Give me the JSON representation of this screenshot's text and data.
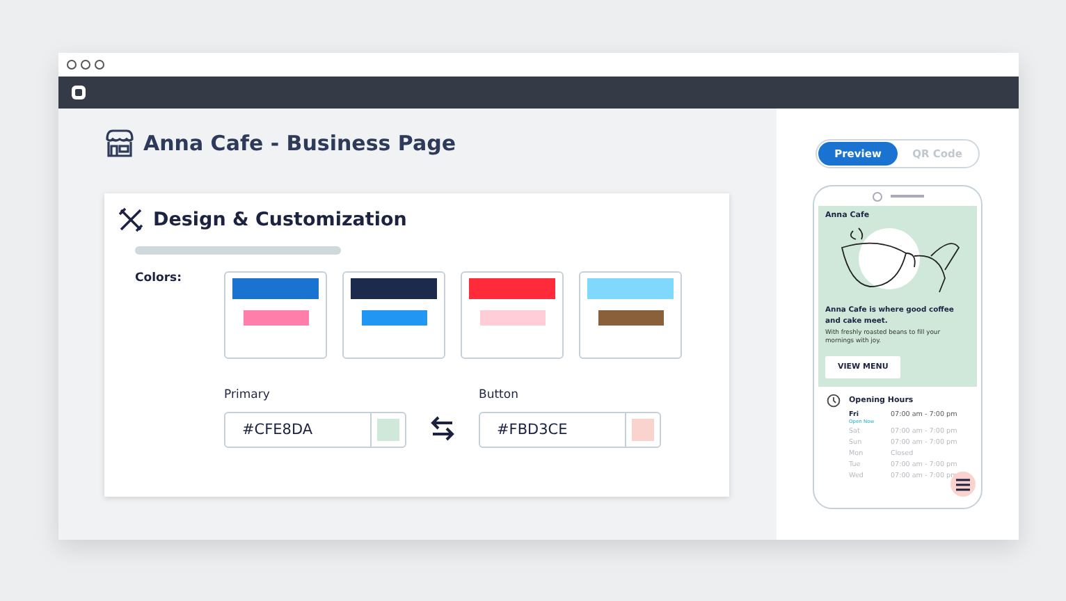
{
  "page": {
    "title": "Anna Cafe - Business Page"
  },
  "design": {
    "title": "Design & Customization",
    "colors_label": "Colors:",
    "palettes": [
      {
        "colors": [
          {
            "color": "#1a73d0"
          },
          {
            "color": "#ff7eaa"
          }
        ]
      },
      {
        "colors": [
          {
            "color": "#1c2a4b"
          },
          {
            "color": "#2196f3"
          }
        ]
      },
      {
        "colors": [
          {
            "color": "#ff2a3a"
          },
          {
            "color": "#ffcdd8"
          }
        ]
      },
      {
        "colors": [
          {
            "color": "#80d8fc"
          },
          {
            "color": "#8a603a"
          }
        ]
      }
    ],
    "primary": {
      "label": "Primary",
      "value": "#CFE8DA",
      "color": "#cfe8da"
    },
    "button": {
      "label": "Button",
      "value": "#FBD3CE",
      "color": "#fbd3ce"
    }
  },
  "preview": {
    "tabs": [
      {
        "label": "Preview",
        "selected": true
      },
      {
        "label": "QR Code",
        "selected": false
      }
    ],
    "phone": {
      "name": "Anna Cafe",
      "headline": "Anna Cafe is where good coffee and cake meet.",
      "subtext": "With freshly roasted beans to fill your mornings with joy.",
      "cta": "VIEW MENU",
      "hours_title": "Opening Hours",
      "hours": [
        {
          "day": "Fri",
          "time": "07:00 am  - 7:00 pm",
          "today": true,
          "note": "Open Now"
        },
        {
          "day": "Sat",
          "time": "07:00 am  - 7:00 pm",
          "today": false
        },
        {
          "day": "Sun",
          "time": "07:00 am  - 7:00 pm",
          "today": false
        },
        {
          "day": "Mon",
          "time": "Closed",
          "today": false
        },
        {
          "day": "Tue",
          "time": "07:00 am  - 7:00 pm",
          "today": false
        },
        {
          "day": "Wed",
          "time": "07:00 am  - 7:00 pm",
          "today": false
        }
      ]
    }
  }
}
